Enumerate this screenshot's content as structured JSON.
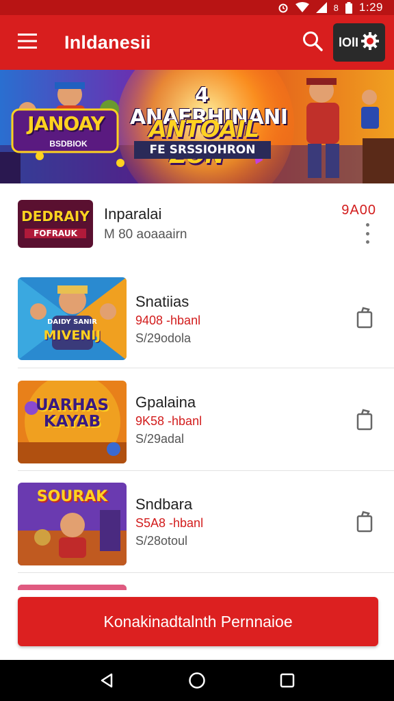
{
  "status_bar": {
    "time": "1:29",
    "signal_label": "8"
  },
  "app_bar": {
    "title": "Inldanesii",
    "profile_label": "lOlI"
  },
  "banner": {
    "line1": "4 ANAERHINANI",
    "line2": "ANTOAIL ZON”",
    "line3": "FE SRSSIOHRON",
    "sign_main": "JANOAY",
    "sign_sub": "BSDBIOK"
  },
  "featured": {
    "thumb_label_1": "DEDRAIY",
    "thumb_label_2": "FOFRAUK",
    "title": "Inparalai",
    "subtitle": "M 80 aoaaairn",
    "price": "9A00"
  },
  "items": [
    {
      "thumb_label": "MIVENIJ",
      "thumb_top": "DAIDY SANIR",
      "title": "Snatiias",
      "price": "9408 -hbanl",
      "meta": "S/29odola"
    },
    {
      "thumb_label": "UARHAS KAYAB",
      "thumb_top": "",
      "title": "Gpalaina",
      "price": "9K58 -hbanl",
      "meta": "S/29adal"
    },
    {
      "thumb_label": "SOURAK",
      "thumb_top": "",
      "title": "Sndbara",
      "price": "S5A8 -hbanl",
      "meta": "S/28otoul"
    }
  ],
  "cta": {
    "label": "Konakinadtalnth Pernnaioe"
  },
  "colors": {
    "primary": "#d81e1e",
    "status_bar": "#b81414",
    "price": "#d21c1c",
    "nav_bar": "#000000"
  },
  "icons": [
    "menu-icon",
    "search-icon",
    "gear-icon",
    "more-vert-icon",
    "shopping-bag-icon",
    "back-icon",
    "home-icon",
    "recents-icon"
  ]
}
